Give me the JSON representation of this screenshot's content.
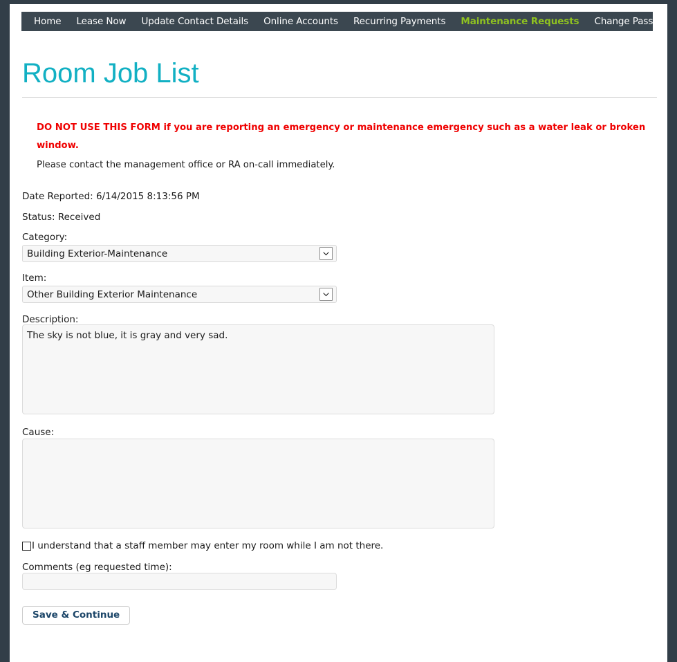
{
  "nav": {
    "items": [
      {
        "label": "Home",
        "active": false
      },
      {
        "label": "Lease Now",
        "active": false
      },
      {
        "label": "Update Contact Details",
        "active": false
      },
      {
        "label": "Online Accounts",
        "active": false
      },
      {
        "label": "Recurring Payments",
        "active": false
      },
      {
        "label": "Maintenance Requests",
        "active": true
      },
      {
        "label": "Change Password",
        "active": false
      }
    ],
    "active_color": "#8fc220",
    "background_color": "#3b4750",
    "text_color": "#ffffff"
  },
  "page": {
    "title": "Room Job List",
    "title_color": "#12b0c3",
    "frame_color": "#323e48"
  },
  "notice": {
    "warning": "DO NOT USE THIS FORM if you are reporting an emergency or maintenance emergency such as a water leak or broken window.",
    "warning_color": "#ef0000",
    "contact": "Please contact the management office or RA on-call immediately."
  },
  "request": {
    "date_reported_label": "Date Reported:",
    "date_reported_value": "6/14/2015 8:13:56 PM",
    "date_reported_line": "Date Reported: 6/14/2015 8:13:56 PM",
    "status_label": "Status:",
    "status_value": "Received",
    "status_line": "Status: Received"
  },
  "form": {
    "category": {
      "label": "Category:",
      "value": "Building Exterior-Maintenance"
    },
    "item": {
      "label": "Item:",
      "value": "Other Building Exterior Maintenance"
    },
    "description": {
      "label": "Description:",
      "value": "The sky is not blue, it is gray and very sad."
    },
    "cause": {
      "label": "Cause:",
      "value": ""
    },
    "consent": {
      "label": "I understand that a staff member may enter my room while I am not there.",
      "checked": false
    },
    "comments": {
      "label": "Comments (eg requested time):",
      "value": "",
      "placeholder": ""
    },
    "submit": {
      "label": "Save & Continue"
    }
  }
}
